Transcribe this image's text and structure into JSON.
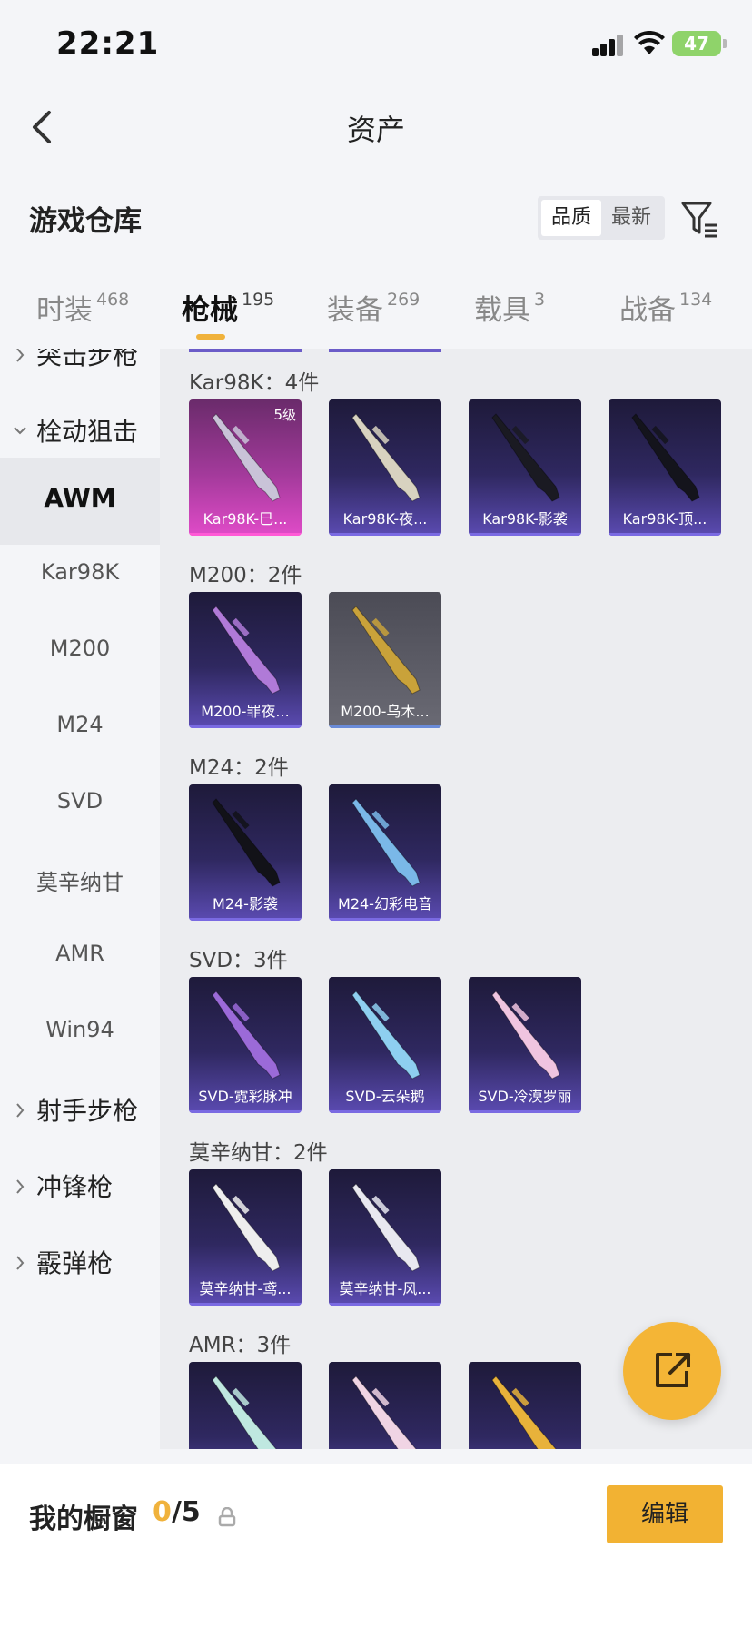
{
  "status": {
    "time": "22:21",
    "battery": "47"
  },
  "nav": {
    "title": "资产"
  },
  "warehouse": {
    "title": "游戏仓库",
    "sort_options": [
      "品质",
      "最新"
    ],
    "active_sort": "品质"
  },
  "tabs": [
    {
      "label": "时装",
      "count": "468"
    },
    {
      "label": "枪械",
      "count": "195",
      "active": true
    },
    {
      "label": "装备",
      "count": "269"
    },
    {
      "label": "载具",
      "count": "3"
    },
    {
      "label": "战备",
      "count": "134"
    }
  ],
  "sidebar": [
    {
      "label": "突击步枪",
      "type": "category",
      "expanded": false
    },
    {
      "label": "栓动狙击",
      "type": "category",
      "expanded": true
    },
    {
      "label": "AWM",
      "type": "sub",
      "selected": true
    },
    {
      "label": "Kar98K",
      "type": "sub"
    },
    {
      "label": "M200",
      "type": "sub"
    },
    {
      "label": "M24",
      "type": "sub"
    },
    {
      "label": "SVD",
      "type": "sub"
    },
    {
      "label": "莫辛纳甘",
      "type": "sub"
    },
    {
      "label": "AMR",
      "type": "sub"
    },
    {
      "label": "Win94",
      "type": "sub"
    },
    {
      "label": "射手步枪",
      "type": "category",
      "expanded": false
    },
    {
      "label": "冲锋枪",
      "type": "category",
      "expanded": false
    },
    {
      "label": "霰弹枪",
      "type": "category",
      "expanded": false
    }
  ],
  "groups": [
    {
      "title": "Kar98K：4件",
      "items": [
        {
          "name": "Kar98K-巳...",
          "style": "pink",
          "level": "5级",
          "gun": "#c9c3d8"
        },
        {
          "name": "Kar98K-夜...",
          "style": "purple",
          "gun": "#d8d2c0"
        },
        {
          "name": "Kar98K-影袭",
          "style": "purple",
          "gun": "#1a1a22"
        },
        {
          "name": "Kar98K-顶...",
          "style": "purple",
          "gun": "#14141c"
        }
      ]
    },
    {
      "title": "M200：2件",
      "items": [
        {
          "name": "M200-罪夜...",
          "style": "purple",
          "gun": "#b07ad8"
        },
        {
          "name": "M200-乌木...",
          "style": "gray",
          "gun": "#c9a23a"
        }
      ]
    },
    {
      "title": "M24：2件",
      "items": [
        {
          "name": "M24-影袭",
          "style": "purple",
          "gun": "#121218"
        },
        {
          "name": "M24-幻彩电音",
          "style": "purple",
          "gun": "#7ab8e8"
        }
      ]
    },
    {
      "title": "SVD：3件",
      "items": [
        {
          "name": "SVD-霓彩脉冲",
          "style": "purple",
          "gun": "#9b6ad8"
        },
        {
          "name": "SVD-云朵鹅",
          "style": "purple",
          "gun": "#8ecff0"
        },
        {
          "name": "SVD-冷漠罗丽",
          "style": "purple",
          "gun": "#f0c4e0"
        }
      ]
    },
    {
      "title": "莫辛纳甘：2件",
      "items": [
        {
          "name": "莫辛纳甘-鸢...",
          "style": "purple",
          "gun": "#eeeeee"
        },
        {
          "name": "莫辛纳甘-风...",
          "style": "purple",
          "gun": "#e8e8f0"
        }
      ]
    },
    {
      "title": "AMR：3件",
      "items": [
        {
          "name": "",
          "style": "purple",
          "gun": "#bfe8e0"
        },
        {
          "name": "",
          "style": "purple",
          "gun": "#f0d4e4"
        },
        {
          "name": "",
          "style": "purple",
          "gun": "#e8b23a"
        }
      ]
    }
  ],
  "showcase": {
    "label": "我的橱窗",
    "current": "0",
    "total": "/5",
    "edit_label": "编辑"
  },
  "colors": {
    "accent": "#f2b233",
    "card_purple": "#5b4bb2",
    "card_pink": "#e04bc8"
  }
}
